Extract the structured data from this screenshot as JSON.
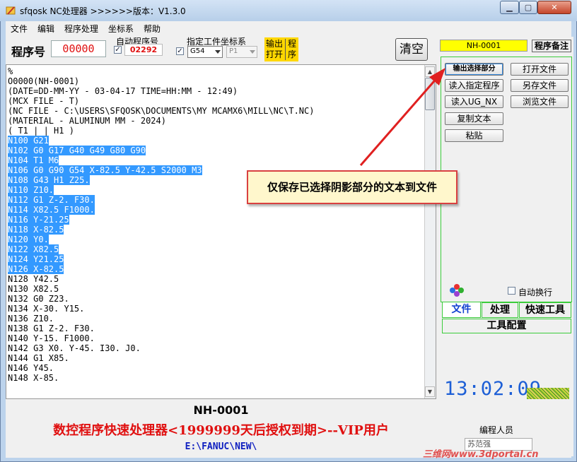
{
  "window": {
    "title": "sfqosk NC处理器 >>>>>>版本：V1.3.0"
  },
  "menu": [
    "文件",
    "编辑",
    "程序处理",
    "坐标系",
    "帮助"
  ],
  "toolbar": {
    "program_number_label": "程序号",
    "program_number_value": "00000",
    "auto_program_label": "自动程序号",
    "auto_program_checked": true,
    "auto_program_value": "02292",
    "wcs_label": "指定工件坐标系",
    "wcs_checked": true,
    "wcs_value": "G54",
    "p_value": "P1",
    "output_open_col1": "输出\n打开",
    "output_open_col2": "程\n序",
    "clear_label": "清空"
  },
  "editor": {
    "lines": [
      {
        "text": "%",
        "selected": false
      },
      {
        "text": "O0000(NH-0001)",
        "selected": false
      },
      {
        "text": "(DATE=DD-MM-YY - 03-04-17 TIME=HH:MM - 12:49)",
        "selected": false
      },
      {
        "text": "(MCX FILE - T)",
        "selected": false
      },
      {
        "text": "(NC FILE - C:\\USERS\\SFQOSK\\DOCUMENTS\\MY MCAMX6\\MILL\\NC\\T.NC)",
        "selected": false
      },
      {
        "text": "(MATERIAL - ALUMINUM MM - 2024)",
        "selected": false
      },
      {
        "text": "( T1 | | H1 )",
        "selected": false
      },
      {
        "text": "N100 G21",
        "selected": true
      },
      {
        "text": "N102 G0 G17 G40 G49 G80 G90",
        "selected": true
      },
      {
        "text": "N104 T1 M6",
        "selected": true
      },
      {
        "text": "N106 G0 G90 G54 X-82.5 Y-42.5 S2000 M3",
        "selected": true
      },
      {
        "text": "N108 G43 H1 Z25.",
        "selected": true
      },
      {
        "text": "N110 Z10.",
        "selected": true
      },
      {
        "text": "N112 G1 Z-2. F30.",
        "selected": true
      },
      {
        "text": "N114 X82.5 F1000.",
        "selected": true
      },
      {
        "text": "N116 Y-21.25",
        "selected": true
      },
      {
        "text": "N118 X-82.5",
        "selected": true
      },
      {
        "text": "N120 Y0.",
        "selected": true
      },
      {
        "text": "N122 X82.5",
        "selected": true
      },
      {
        "text": "N124 Y21.25",
        "selected": true
      },
      {
        "text": "N126 X-82.5",
        "selected": true
      },
      {
        "text": "N128 Y42.5",
        "selected": false
      },
      {
        "text": "N130 X82.5",
        "selected": false
      },
      {
        "text": "N132 G0 Z23.",
        "selected": false
      },
      {
        "text": "N134 X-30. Y15.",
        "selected": false
      },
      {
        "text": "N136 Z10.",
        "selected": false
      },
      {
        "text": "N138 G1 Z-2. F30.",
        "selected": false
      },
      {
        "text": "N140 Y-15. F1000.",
        "selected": false
      },
      {
        "text": "N142 G3 X0. Y-45. I30. J0.",
        "selected": false
      },
      {
        "text": "N144 G1 X85.",
        "selected": false
      },
      {
        "text": "N146 Y45.",
        "selected": false
      },
      {
        "text": "N148 X-85.",
        "selected": false
      }
    ],
    "filename": "NH-0001",
    "status": "数控程序快速处理器<1999999天后授权到期>--VIP用户",
    "path": "E:\\FANUC\\NEW\\"
  },
  "right_panel": {
    "nh_tag": "NH-0001",
    "remark_label": "程序备注",
    "buttons_left": [
      "输出选择部分",
      "读入指定程序",
      "读入UG_NX",
      "复制文本",
      "粘贴"
    ],
    "buttons_right": [
      "打开文件",
      "另存文件",
      "浏览文件"
    ],
    "auto_wrap_label": "自动换行",
    "tabs": [
      "文件",
      "处理",
      "快速工具"
    ],
    "config_tab": "工具配置",
    "clock": "13:02:09",
    "programmer_label": "编程人员",
    "programmer_value": "苏范强",
    "watermark": "三维网www.3dportal.cn"
  },
  "callout": {
    "text": "仅保存已选择阴影部分的文本到文件",
    "color": "#d94040"
  },
  "colors": {
    "selection": "#3399ff",
    "accent_red": "#e01010",
    "panel_border": "#3bcc3b",
    "clock": "#1d5fd6",
    "highlight_yellow": "#ffff00"
  }
}
